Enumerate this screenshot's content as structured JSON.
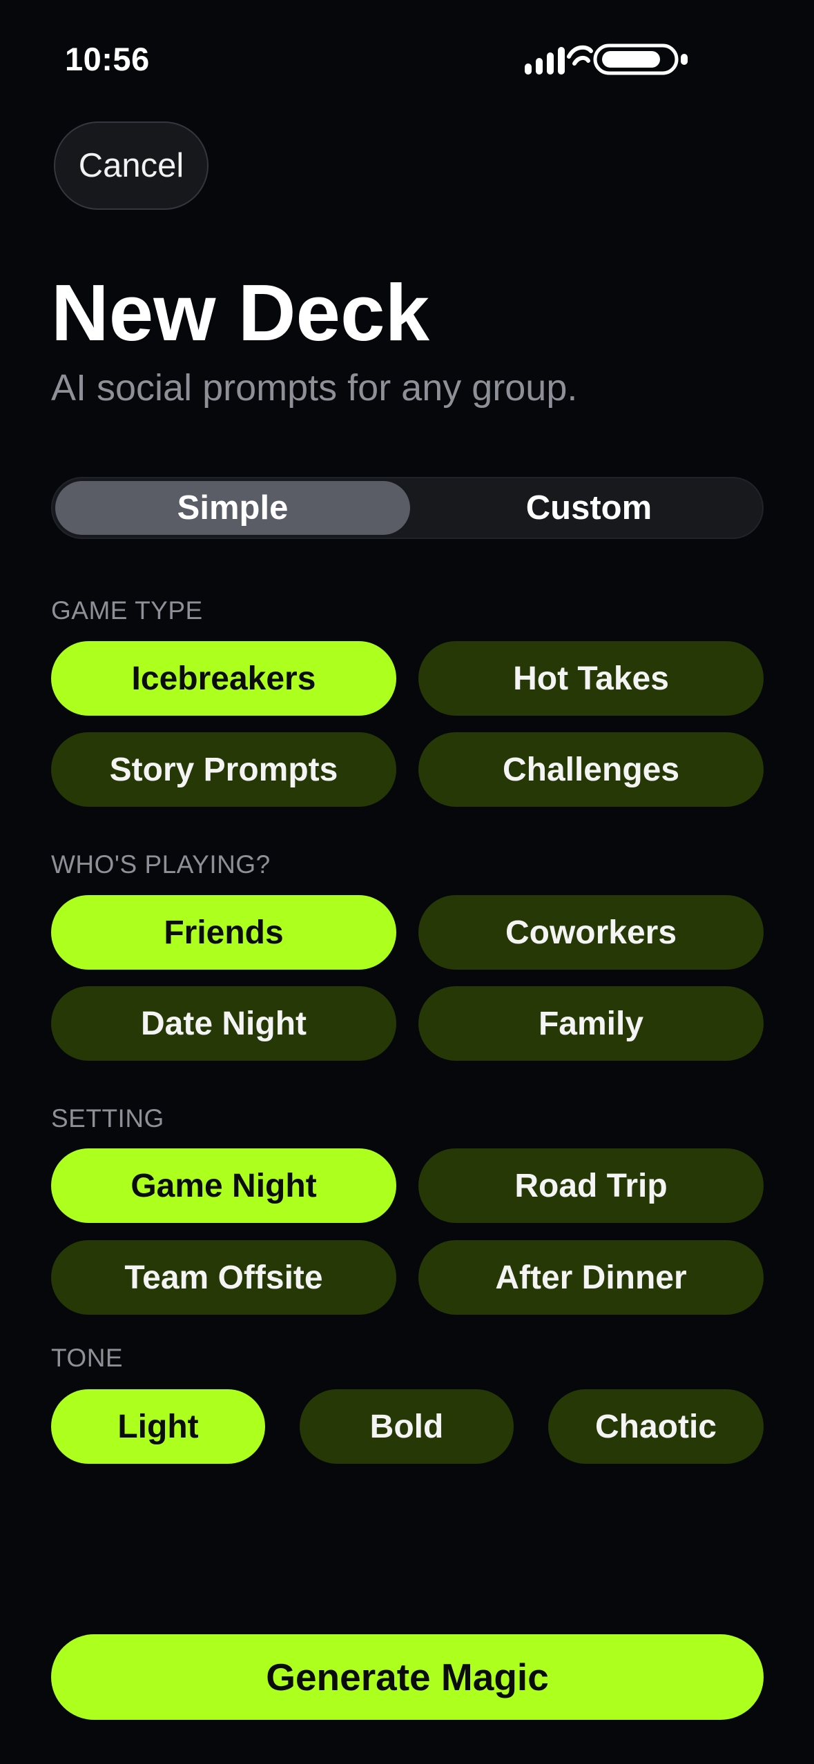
{
  "status_bar": {
    "time": "10:56"
  },
  "header": {
    "cancel_label": "Cancel",
    "title": "New Deck",
    "subtitle": "AI social prompts for any group."
  },
  "mode_toggle": {
    "options": [
      "Simple",
      "Custom"
    ],
    "selected": "Simple"
  },
  "sections": {
    "game_type": {
      "label": "GAME TYPE",
      "options": [
        "Icebreakers",
        "Hot Takes",
        "Story Prompts",
        "Challenges"
      ],
      "selected": "Icebreakers"
    },
    "players": {
      "label": "WHO'S PLAYING?",
      "options": [
        "Friends",
        "Coworkers",
        "Date Night",
        "Family"
      ],
      "selected": "Friends"
    },
    "setting": {
      "label": "SETTING",
      "options": [
        "Game Night",
        "Road Trip",
        "Team Offsite",
        "After Dinner"
      ],
      "selected": "Game Night"
    },
    "tone": {
      "label": "TONE",
      "options": [
        "Light",
        "Bold",
        "Chaotic"
      ],
      "selected": "Light"
    }
  },
  "footer": {
    "generate_label": "Generate Magic"
  },
  "colors": {
    "background": "#06070a",
    "accent": "#adff1d",
    "chip_unselected": "#253805",
    "muted_text": "#8e9097"
  },
  "icons": [
    "signal-icon",
    "wifi-icon",
    "battery-icon"
  ]
}
